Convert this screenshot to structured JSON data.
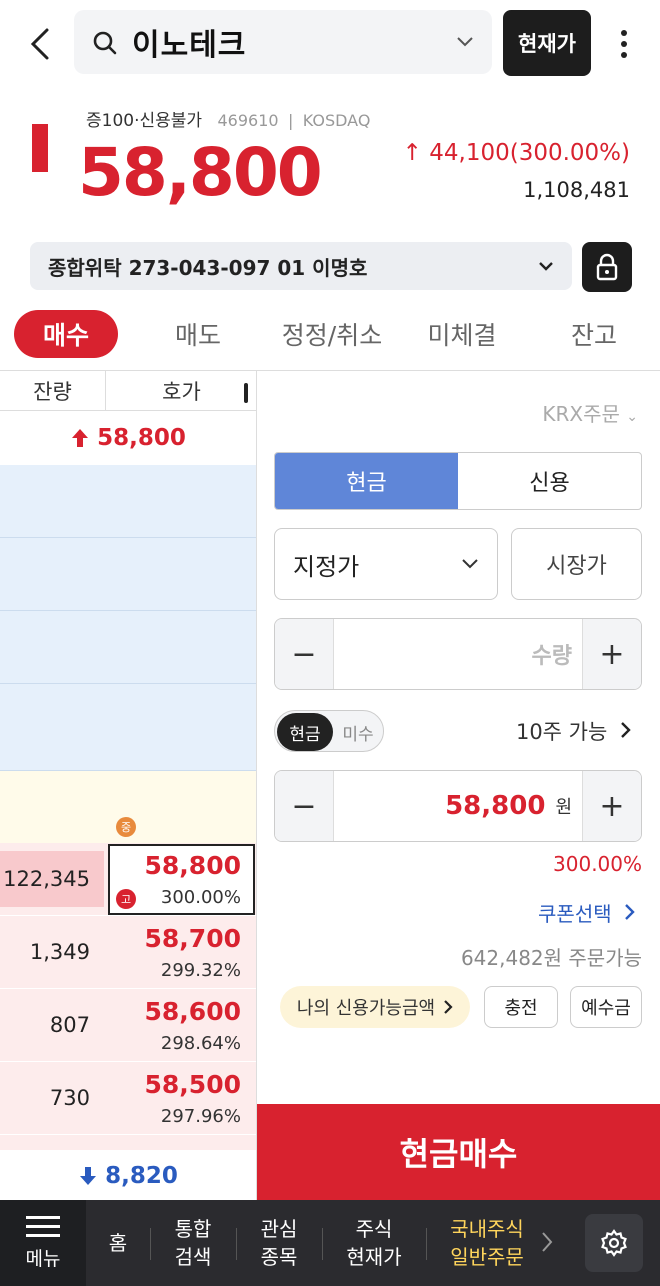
{
  "header": {
    "stock_name": "이노테크",
    "current_price_button": "현재가"
  },
  "stock": {
    "tags": "증100·신용불가",
    "code": "469610",
    "market": "KOSDAQ",
    "price": "58,800",
    "change": "↑ 44,100(300.00%)",
    "volume": "1,108,481"
  },
  "account": {
    "label": "종합위탁  273-043-097 01  이명호"
  },
  "tabs": [
    "매수",
    "매도",
    "정정/취소",
    "미체결",
    "잔고"
  ],
  "orderbook": {
    "col_remain": "잔량",
    "col_quote": "호가",
    "high": "58,800",
    "mid_badge": "중",
    "high_badge": "고",
    "bids": [
      {
        "qty": "122,345",
        "price": "58,800",
        "pct": "300.00%"
      },
      {
        "qty": "1,349",
        "price": "58,700",
        "pct": "299.32%"
      },
      {
        "qty": "807",
        "price": "58,600",
        "pct": "298.64%"
      },
      {
        "qty": "730",
        "price": "58,500",
        "pct": "297.96%"
      }
    ],
    "low": "8,820"
  },
  "order_panel": {
    "krx": "KRX주문",
    "seg_cash": "현금",
    "seg_credit": "신용",
    "order_type": "지정가",
    "market_price": "시장가",
    "qty_placeholder": "수량",
    "toggle_cash": "현금",
    "toggle_misu": "미수",
    "available": "10주 가능",
    "price_value": "58,800",
    "price_unit": "원",
    "price_pct": "300.00%",
    "coupon": "쿠폰선택",
    "orderable": "642,482원 주문가능",
    "credit_amount": "나의 신용가능금액",
    "charge": "충전",
    "deposit": "예수금",
    "buy_button": "현금매수"
  },
  "bottom_nav": {
    "menu": "메뉴",
    "items": [
      "홈",
      "통합\n검색",
      "관심\n종목",
      "주식\n현재가",
      "국내주식\n일반주문"
    ]
  },
  "colors": {
    "rise": "#d8222f",
    "fall": "#2a5bbf",
    "accent_blue": "#5f86d8"
  }
}
